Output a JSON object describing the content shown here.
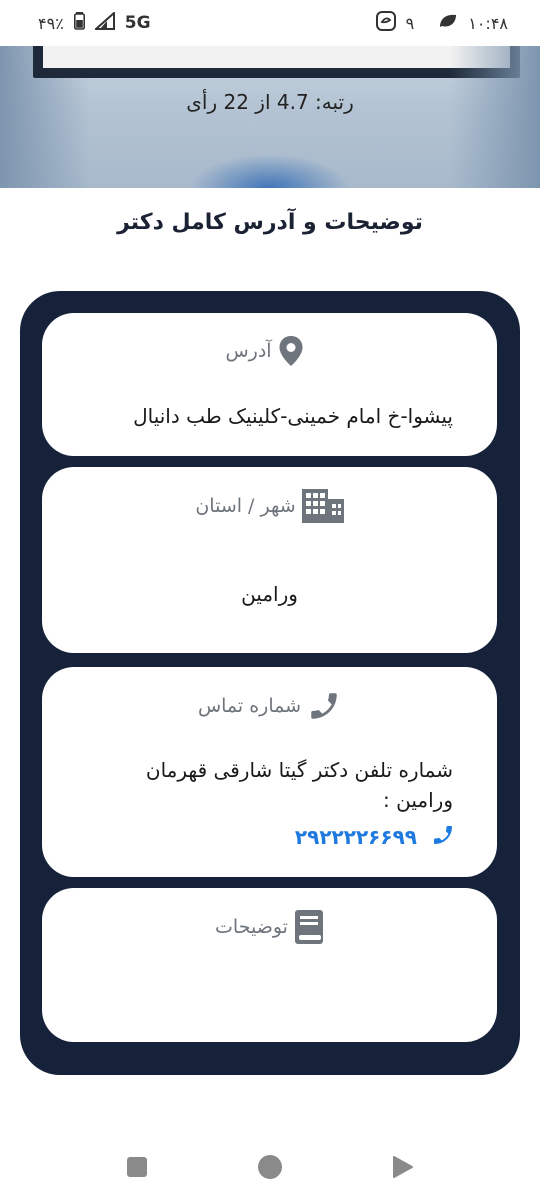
{
  "status_bar": {
    "battery": "۴۹٪",
    "network": "5G",
    "notif_count": "۹",
    "time": "۱۰:۴۸"
  },
  "hero": {
    "rating_text": "رتبه: 4.7 از 22 رأی"
  },
  "section": {
    "title": "توضیحات و آدرس کامل دکتر"
  },
  "cards": {
    "address": {
      "label": "آدرس",
      "icon": "map-pin-icon",
      "value": "پیشوا-خ امام خمینی-کلینیک طب دانیال"
    },
    "city": {
      "label": "شهر / استان",
      "icon": "building-icon",
      "value": "ورامین"
    },
    "contact": {
      "label": "شماره تماس",
      "icon": "phone-icon",
      "description": "شماره تلفن دکتر گیتا شارقی قهرمان ورامین :",
      "phone": "۲۹۲۲۲۲۶۶۹۹"
    },
    "notes": {
      "label": "توضیحات",
      "icon": "book-icon"
    }
  },
  "colors": {
    "container": "#15223a",
    "accent_blue": "#1f7ae0",
    "label_gray": "#6f757c"
  }
}
